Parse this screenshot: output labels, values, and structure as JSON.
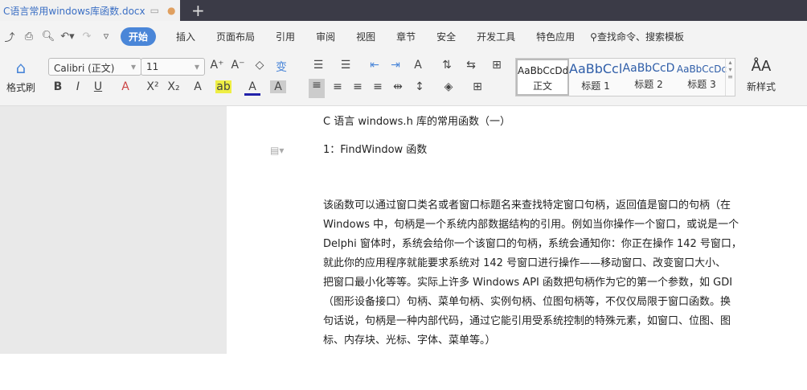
{
  "tab": {
    "title": "C语言常用windows库函数.docx",
    "new_tab": "+"
  },
  "menu": [
    "开始",
    "插入",
    "页面布局",
    "引用",
    "审阅",
    "视图",
    "章节",
    "安全",
    "开发工具",
    "特色应用"
  ],
  "search": "查找命令、搜索模板",
  "toolbar": {
    "format_painter": "格式刷",
    "font": "Calibri (正文)",
    "size": "11",
    "new_style": "新样式"
  },
  "styles": [
    {
      "preview": "AaBbCcDd",
      "label": "正文"
    },
    {
      "preview": "AaBbCcl",
      "label": "标题 1"
    },
    {
      "preview": "AaBbCcD",
      "label": "标题 2"
    },
    {
      "preview": "AaBbCcDc",
      "label": "标题 3"
    }
  ],
  "document": {
    "title": "C 语言 windows.h 库的常用函数（一）",
    "heading": "1：FindWindow 函数",
    "paragraph": [
      "该函数可以通过窗口类名或者窗口标题名来查找特定窗口句柄，返回值是窗口的句柄（在",
      "Windows 中，句柄是一个系统内部数据结构的引用。例如当你操作一个窗口，或说是一个",
      "Delphi 窗体时，系统会给你一个该窗口的句柄，系统会通知你：你正在操作 142 号窗口，",
      "就此你的应用程序就能要求系统对 142 号窗口进行操作——移动窗口、改变窗口大小、",
      "把窗口最小化等等。实际上许多 Windows API 函数把句柄作为它的第一个参数，如 GDI",
      "（图形设备接口）句柄、菜单句柄、实例句柄、位图句柄等，不仅仅局限于窗口函数。换",
      "句话说，句柄是一种内部代码，通过它能引用受系统控制的特殊元素，如窗口、位图、图",
      "标、内存块、光标、字体、菜单等。）"
    ]
  }
}
